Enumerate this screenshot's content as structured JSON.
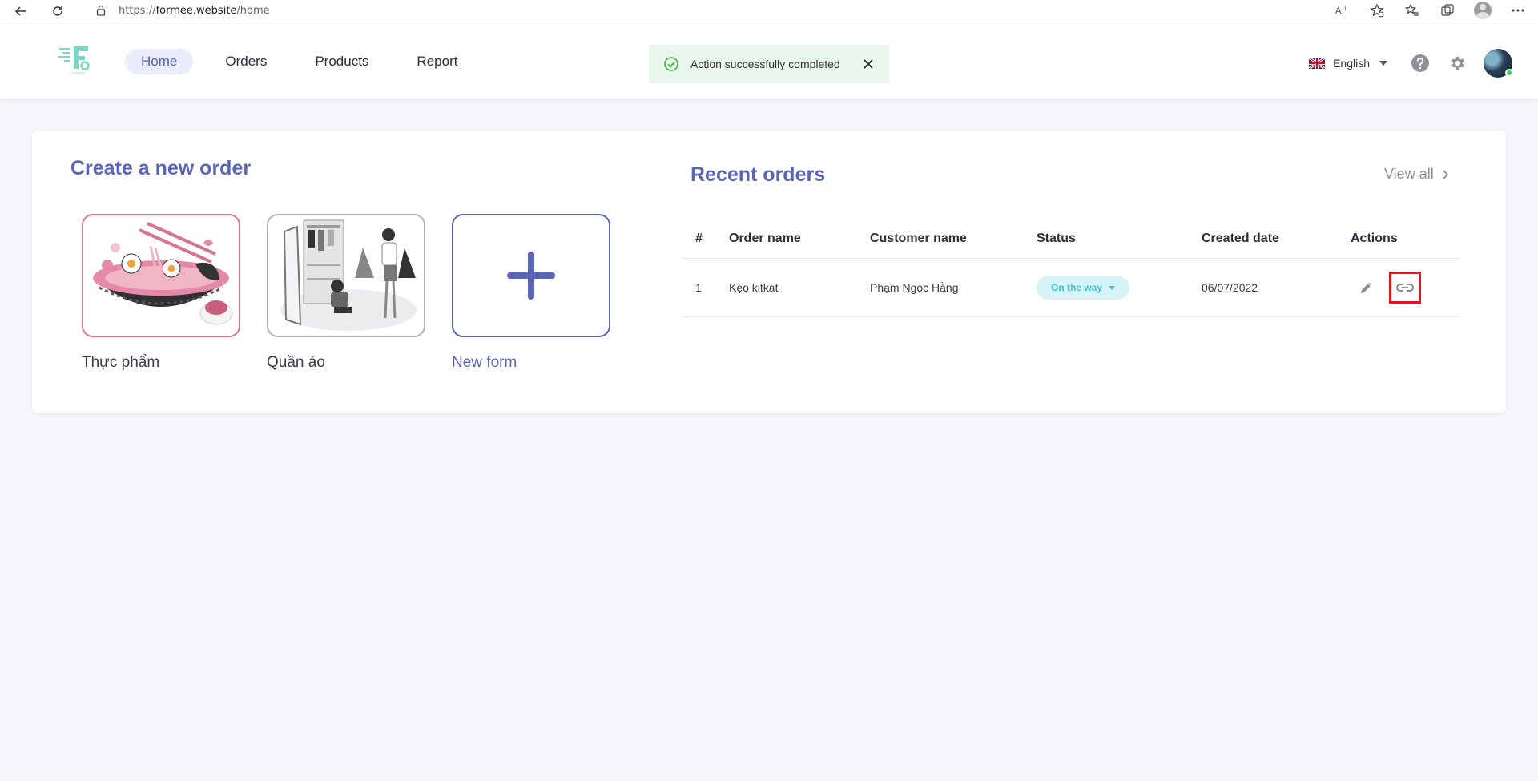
{
  "browser": {
    "url_scheme": "https://",
    "url_domain": "formee.website",
    "url_path": "/home"
  },
  "header": {
    "nav": [
      {
        "label": "Home",
        "active": true
      },
      {
        "label": "Orders",
        "active": false
      },
      {
        "label": "Products",
        "active": false
      },
      {
        "label": "Report",
        "active": false
      }
    ],
    "toast": "Action successfully completed",
    "language": "English"
  },
  "create": {
    "title": "Create a new order",
    "tiles": [
      {
        "label": "Thực phẩm"
      },
      {
        "label": "Quần áo"
      },
      {
        "label": "New form"
      }
    ]
  },
  "recent": {
    "title": "Recent orders",
    "view_all": "View all",
    "columns": [
      "#",
      "Order name",
      "Customer name",
      "Status",
      "Created date",
      "Actions"
    ],
    "rows": [
      {
        "index": "1",
        "order_name": "Kẹo kitkat",
        "customer": "Phạm Ngọc Hằng",
        "status": "On the way",
        "created": "06/07/2022"
      }
    ]
  },
  "colors": {
    "accent": "#5a65b6",
    "status_bg": "#d6f4f6",
    "status_text": "#3cc3d0",
    "toast_bg": "#e9f6ec",
    "highlight": "#e0161e"
  }
}
